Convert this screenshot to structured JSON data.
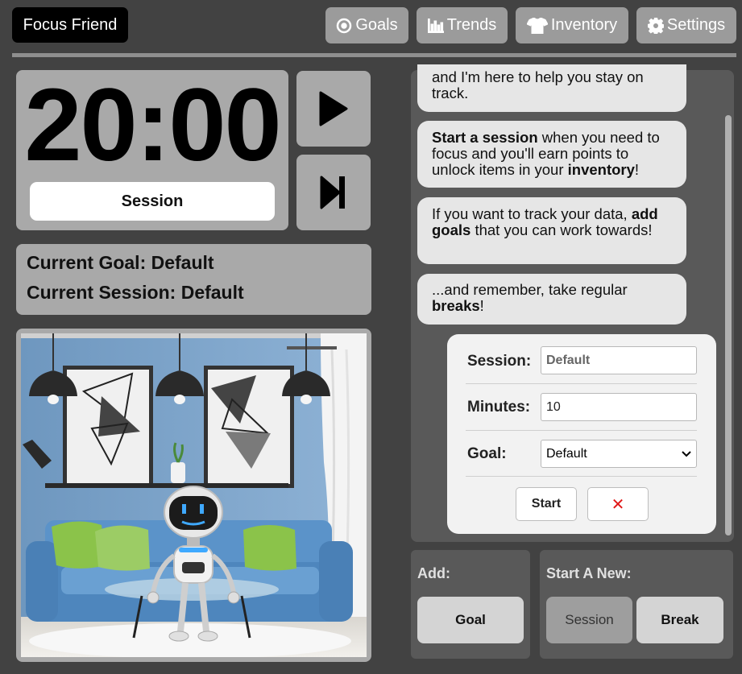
{
  "app": {
    "title": "Focus Friend"
  },
  "nav": {
    "goals": "Goals",
    "trends": "Trends",
    "inventory": "Inventory",
    "settings": "Settings"
  },
  "timer": {
    "time": "20:00",
    "mode": "Session"
  },
  "info": {
    "goal": "Current Goal: Default",
    "session": "Current Session: Default"
  },
  "chat": {
    "bubble1": {
      "line1": "and I'm here to help you stay on",
      "line2": "track."
    },
    "bubble2": {
      "bold1": "Start a session",
      "text1": " when you need to focus and you'll earn points to unlock items in your ",
      "bold2": "inventory",
      "text2": "!"
    },
    "bubble3": {
      "text1": "If you want to track your data, ",
      "bold1": "add goals",
      "text2": " that you can work towards!"
    },
    "bubble4": {
      "text1": "...and remember, take regular ",
      "bold1": "breaks",
      "text2": "!"
    }
  },
  "form": {
    "session_label": "Session:",
    "session_value": "Default",
    "minutes_label": "Minutes:",
    "minutes_value": "10",
    "goal_label": "Goal:",
    "goal_value": "Default",
    "start_label": "Start",
    "cancel_label": "✕"
  },
  "add": {
    "heading": "Add:",
    "goal_button": "Goal"
  },
  "start_new": {
    "heading": "Start A New:",
    "session_button": "Session",
    "break_button": "Break"
  },
  "colors": {
    "background": "#424242",
    "panel": "#a9a9a9",
    "chat_panel": "#595959",
    "bubble": "#e6e6e6",
    "brand": "#000000",
    "cancel_red": "#e01818"
  },
  "icons": {
    "goals": "target-icon",
    "trends": "bar-chart-icon",
    "inventory": "tshirt-icon",
    "settings": "gear-icon",
    "play": "play-icon",
    "skip": "skip-forward-icon",
    "select": "chevron-down-icon"
  }
}
